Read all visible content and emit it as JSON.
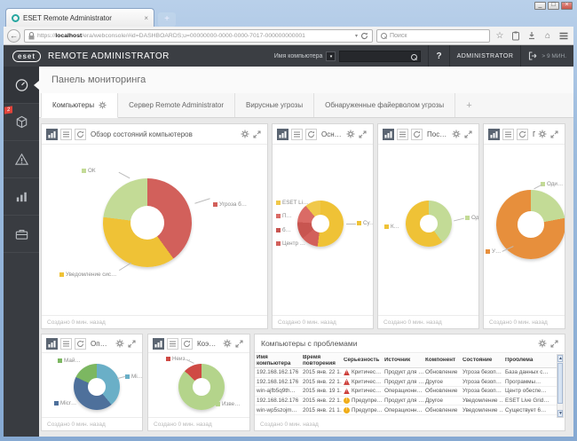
{
  "browser": {
    "tab_title": "ESET Remote Administrator",
    "url_prefix": "https://",
    "url_host": "localhost",
    "url_path": "/era/webconsole/#id=DASHBOARDS;u=00000000-0000-0000-7017-000000000001",
    "search_placeholder": "Поиск"
  },
  "header": {
    "logo": "eset",
    "brand": "REMOTE ADMINISTRATOR",
    "search_type_label": "Имя компьютера",
    "help": "?",
    "user": "ADMINISTRATOR",
    "session": "> 9 МИН."
  },
  "sidebar": {
    "computers_badge": "2"
  },
  "page": {
    "title": "Панель мониторинга"
  },
  "dash_tabs": [
    {
      "label": "Компьютеры"
    },
    {
      "label": "Сервер Remote Administrator"
    },
    {
      "label": "Вирусные угрозы"
    },
    {
      "label": "Обнаруженные файерволом угрозы"
    },
    {
      "label": "+"
    }
  ],
  "footer_text": "Создано 0 мин. назад",
  "panels": [
    {
      "title": "Обзор состояний компьютеров",
      "chart_data": {
        "type": "pie",
        "slices": [
          {
            "label": "Угроза б…",
            "value": 40,
            "color": "#d2605b"
          },
          {
            "label": "Уведомление сис…",
            "value": 37,
            "color": "#efc236"
          },
          {
            "label": "ОК",
            "value": 23,
            "color": "#c3db96"
          }
        ]
      }
    },
    {
      "title": "Основ…",
      "chart_data": {
        "type": "pie",
        "slices": [
          {
            "label": "Су…",
            "value": 52,
            "color": "#efc236"
          },
          {
            "label": "Центр …",
            "value": 12,
            "color": "#d2605b"
          },
          {
            "label": "б…",
            "value": 12,
            "color": "#c85550"
          },
          {
            "label": "П…",
            "value": 13,
            "color": "#da6b66"
          },
          {
            "label": "ESET Li…",
            "value": 11,
            "color": "#f0c84a"
          }
        ]
      }
    },
    {
      "title": "После…",
      "chart_data": {
        "type": "pie",
        "slices": [
          {
            "label": "Од…",
            "value": 40,
            "color": "#c3db96"
          },
          {
            "label": "К…",
            "value": 60,
            "color": "#efc236"
          }
        ]
      }
    },
    {
      "title": "Послед…",
      "chart_data": {
        "type": "pie",
        "slices": [
          {
            "label": "Оди…",
            "value": 22,
            "color": "#c3db96"
          },
          {
            "label": "У…",
            "value": 78,
            "color": "#e78f3c"
          }
        ]
      }
    },
    {
      "title": "Опера…",
      "chart_data": {
        "type": "pie",
        "slices": [
          {
            "label": "Mi…",
            "value": 39,
            "color": "#6aafc7"
          },
          {
            "label": "Micr…",
            "value": 43,
            "color": "#4e709b"
          },
          {
            "label": "Май…",
            "value": 18,
            "color": "#7cb761"
          }
        ]
      }
    },
    {
      "title": "Коэфф…",
      "chart_data": {
        "type": "pie",
        "slices": [
          {
            "label": "Изве…",
            "value": 87,
            "color": "#b4d48b"
          },
          {
            "label": "Неиз…",
            "value": 13,
            "color": "#cf4a44"
          }
        ]
      }
    }
  ],
  "table": {
    "title": "Компьютеры с проблемами",
    "columns": [
      "Имя компьютера",
      "Время повторения",
      "Серьезность",
      "Источник",
      "Компонент",
      "Состояние",
      "Проблема"
    ],
    "rows": [
      {
        "severity": "critical",
        "cells": [
          "192.168.162.176",
          "2015 янв. 22 1…",
          "Критичес…",
          "Продукт для …",
          "Обновление",
          "Угроза безоп…",
          "База данных с…"
        ]
      },
      {
        "severity": "critical",
        "cells": [
          "192.168.162.176",
          "2015 янв. 22 1…",
          "Критичес…",
          "Продукт для …",
          "Другое",
          "Угроза безоп…",
          "Программы…"
        ]
      },
      {
        "severity": "critical",
        "cells": [
          "win-ajfb5q9th…",
          "2015 янв. 19 1…",
          "Критичес…",
          "Операционн…",
          "Обновление",
          "Угроза безоп…",
          "Центр обеспе…"
        ]
      },
      {
        "severity": "warning",
        "cells": [
          "192.168.162.176",
          "2015 янв. 22 1…",
          "Предупре…",
          "Продукт для …",
          "Другое",
          "Уведомление …",
          "ESET Live Grid…"
        ]
      },
      {
        "severity": "warning",
        "cells": [
          "win-wp5szojm…",
          "2015 янв. 21 1…",
          "Предупре…",
          "Операционн…",
          "Обновление",
          "Уведомление …",
          "Существует 6…"
        ]
      }
    ]
  }
}
